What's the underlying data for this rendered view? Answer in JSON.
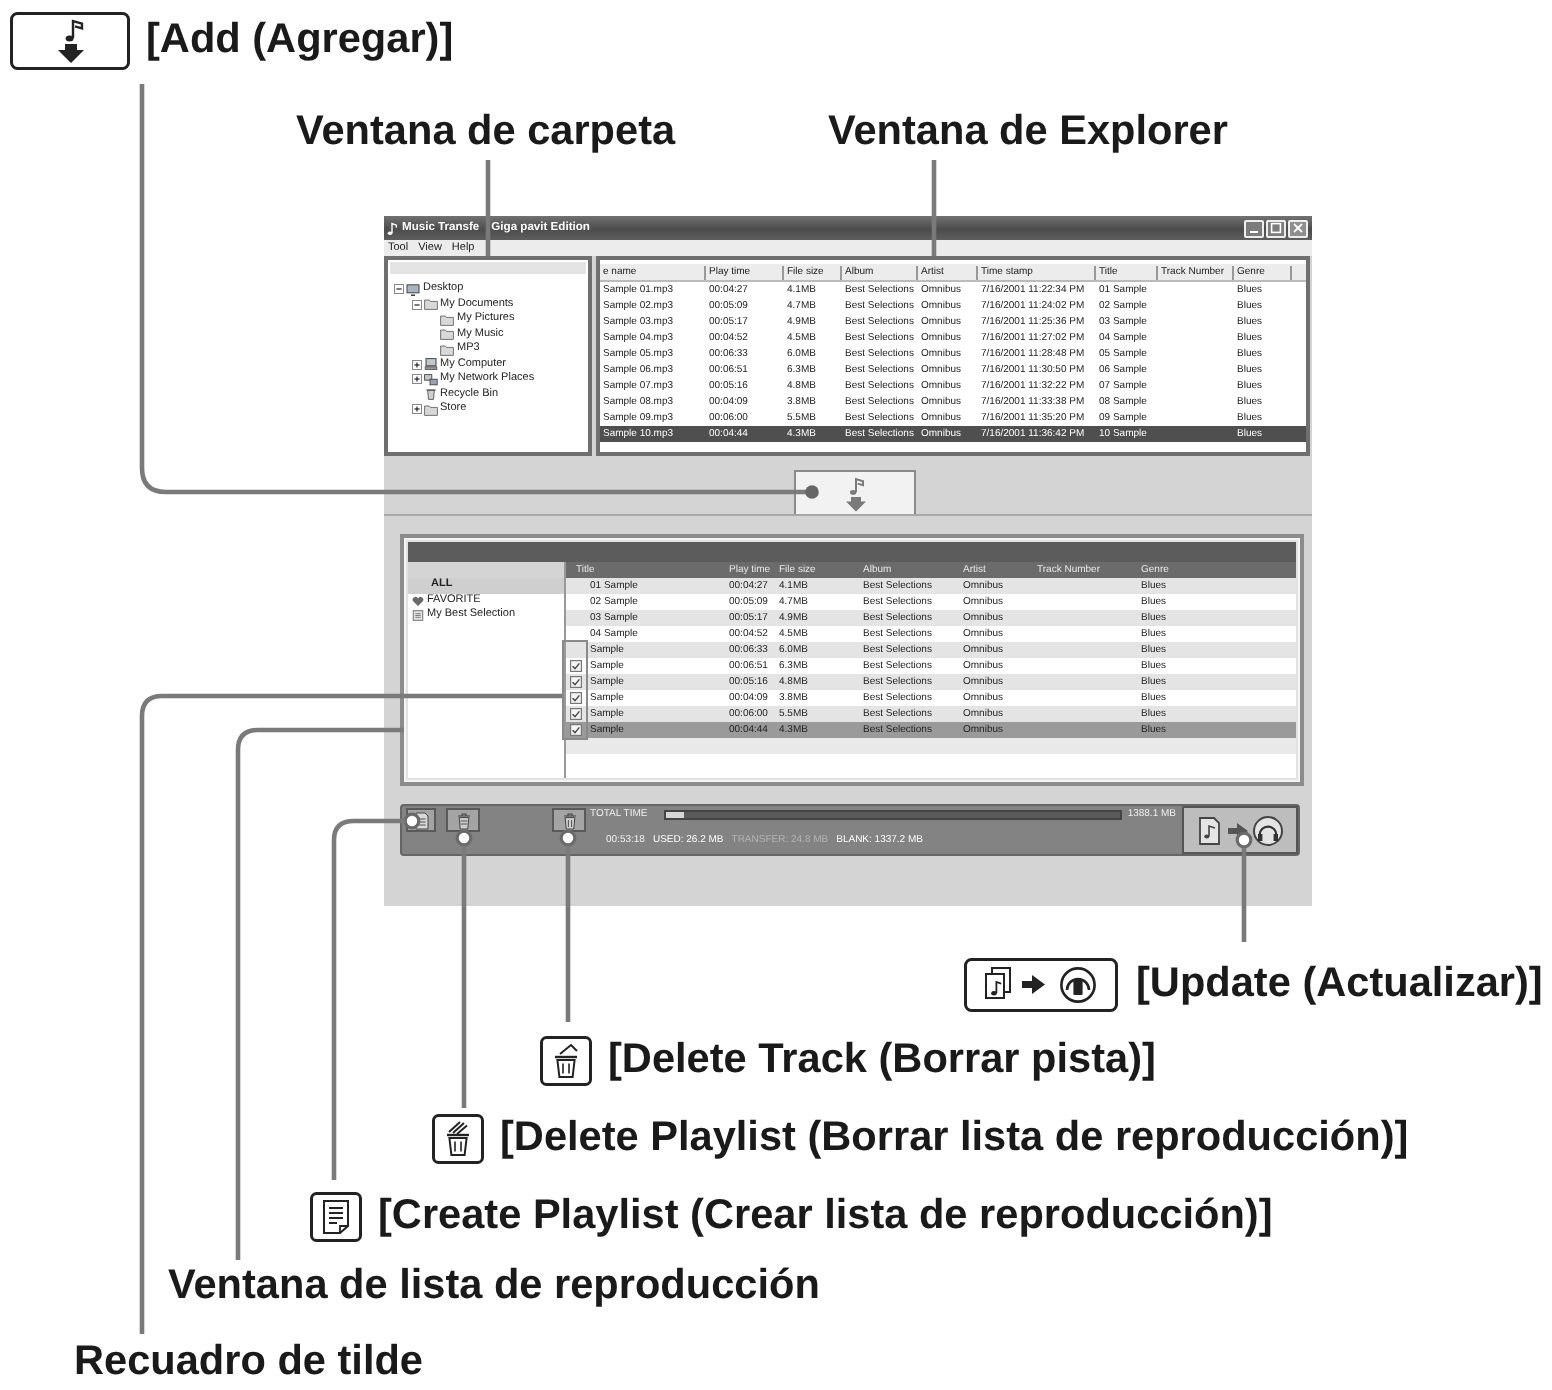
{
  "top_callouts": {
    "add": "[Add (Agregar)]",
    "folder_window": "Ventana de carpeta",
    "explorer_window": "Ventana de Explorer"
  },
  "app": {
    "title_parts": [
      "Music Transfe",
      "Giga pavit Edition"
    ],
    "menu": [
      "Tool",
      "View",
      "Help"
    ],
    "folder_tree": [
      {
        "label": "Desktop",
        "kind": "desktop",
        "expanded": true,
        "children": [
          {
            "label": "My Documents",
            "kind": "folder",
            "expanded": true,
            "children": [
              {
                "label": "My Pictures",
                "kind": "folder"
              },
              {
                "label": "My Music",
                "kind": "folder"
              },
              {
                "label": "MP3",
                "kind": "folder"
              }
            ]
          },
          {
            "label": "My Computer",
            "kind": "computer",
            "expanded": false
          },
          {
            "label": "My Network Places",
            "kind": "network",
            "expanded": false
          },
          {
            "label": "Recycle Bin",
            "kind": "trash"
          },
          {
            "label": "Store",
            "kind": "folder",
            "expanded": false
          }
        ]
      }
    ],
    "explorer_table": {
      "columns": [
        "e name",
        "Play time",
        "File size",
        "Album",
        "Artist",
        "Time stamp",
        "Title",
        "Track Number",
        "Genre"
      ],
      "rows": [
        {
          "file": "Sample 01.mp3",
          "play_time": "00:04:27",
          "file_size": "4.1MB",
          "album": "Best Selections",
          "artist": "Omnibus",
          "time_stamp": "7/16/2001 11:22:34 PM",
          "title": "01 Sample",
          "genre": "Blues",
          "selected": false
        },
        {
          "file": "Sample 02.mp3",
          "play_time": "00:05:09",
          "file_size": "4.7MB",
          "album": "Best Selections",
          "artist": "Omnibus",
          "time_stamp": "7/16/2001 11:24:02 PM",
          "title": "02 Sample",
          "genre": "Blues",
          "selected": false
        },
        {
          "file": "Sample 03.mp3",
          "play_time": "00:05:17",
          "file_size": "4.9MB",
          "album": "Best Selections",
          "artist": "Omnibus",
          "time_stamp": "7/16/2001 11:25:36 PM",
          "title": "03 Sample",
          "genre": "Blues",
          "selected": false
        },
        {
          "file": "Sample 04.mp3",
          "play_time": "00:04:52",
          "file_size": "4.5MB",
          "album": "Best Selections",
          "artist": "Omnibus",
          "time_stamp": "7/16/2001 11:27:02 PM",
          "title": "04 Sample",
          "genre": "Blues",
          "selected": false
        },
        {
          "file": "Sample 05.mp3",
          "play_time": "00:06:33",
          "file_size": "6.0MB",
          "album": "Best Selections",
          "artist": "Omnibus",
          "time_stamp": "7/16/2001 11:28:48 PM",
          "title": "05 Sample",
          "genre": "Blues",
          "selected": false
        },
        {
          "file": "Sample 06.mp3",
          "play_time": "00:06:51",
          "file_size": "6.3MB",
          "album": "Best Selections",
          "artist": "Omnibus",
          "time_stamp": "7/16/2001 11:30:50 PM",
          "title": "06 Sample",
          "genre": "Blues",
          "selected": false
        },
        {
          "file": "Sample 07.mp3",
          "play_time": "00:05:16",
          "file_size": "4.8MB",
          "album": "Best Selections",
          "artist": "Omnibus",
          "time_stamp": "7/16/2001 11:32:22 PM",
          "title": "07 Sample",
          "genre": "Blues",
          "selected": false
        },
        {
          "file": "Sample 08.mp3",
          "play_time": "00:04:09",
          "file_size": "3.8MB",
          "album": "Best Selections",
          "artist": "Omnibus",
          "time_stamp": "7/16/2001 11:33:38 PM",
          "title": "08 Sample",
          "genre": "Blues",
          "selected": false
        },
        {
          "file": "Sample 09.mp3",
          "play_time": "00:06:00",
          "file_size": "5.5MB",
          "album": "Best Selections",
          "artist": "Omnibus",
          "time_stamp": "7/16/2001 11:35:20 PM",
          "title": "09 Sample",
          "genre": "Blues",
          "selected": false
        },
        {
          "file": "Sample 10.mp3",
          "play_time": "00:04:44",
          "file_size": "4.3MB",
          "album": "Best Selections",
          "artist": "Omnibus",
          "time_stamp": "7/16/2001 11:36:42 PM",
          "title": "10 Sample",
          "genre": "Blues",
          "selected": true
        }
      ]
    },
    "playlists": [
      {
        "label": "ALL",
        "kind": "all",
        "selected": true
      },
      {
        "label": "FAVORITE",
        "kind": "favorite",
        "selected": false
      },
      {
        "label": "My Best Selection",
        "kind": "playlist",
        "selected": false
      }
    ],
    "track_table": {
      "columns": [
        "Title",
        "Play time",
        "File size",
        "Album",
        "Artist",
        "Track Number",
        "Genre"
      ],
      "rows": [
        {
          "title": "01 Sample",
          "play_time": "00:04:27",
          "file_size": "4.1MB",
          "album": "Best Selections",
          "artist": "Omnibus",
          "genre": "Blues",
          "checked": false,
          "selected": false
        },
        {
          "title": "02 Sample",
          "play_time": "00:05:09",
          "file_size": "4.7MB",
          "album": "Best Selections",
          "artist": "Omnibus",
          "genre": "Blues",
          "checked": false,
          "selected": false
        },
        {
          "title": "03 Sample",
          "play_time": "00:05:17",
          "file_size": "4.9MB",
          "album": "Best Selections",
          "artist": "Omnibus",
          "genre": "Blues",
          "checked": false,
          "selected": false
        },
        {
          "title": "04 Sample",
          "play_time": "00:04:52",
          "file_size": "4.5MB",
          "album": "Best Selections",
          "artist": "Omnibus",
          "genre": "Blues",
          "checked": false,
          "selected": false
        },
        {
          "title": "Sample",
          "play_time": "00:06:33",
          "file_size": "6.0MB",
          "album": "Best Selections",
          "artist": "Omnibus",
          "genre": "Blues",
          "checked": false,
          "selected": false
        },
        {
          "title": "Sample",
          "play_time": "00:06:51",
          "file_size": "6.3MB",
          "album": "Best Selections",
          "artist": "Omnibus",
          "genre": "Blues",
          "checked": true,
          "selected": false
        },
        {
          "title": "Sample",
          "play_time": "00:05:16",
          "file_size": "4.8MB",
          "album": "Best Selections",
          "artist": "Omnibus",
          "genre": "Blues",
          "checked": true,
          "selected": false
        },
        {
          "title": "Sample",
          "play_time": "00:04:09",
          "file_size": "3.8MB",
          "album": "Best Selections",
          "artist": "Omnibus",
          "genre": "Blues",
          "checked": true,
          "selected": false
        },
        {
          "title": "Sample",
          "play_time": "00:06:00",
          "file_size": "5.5MB",
          "album": "Best Selections",
          "artist": "Omnibus",
          "genre": "Blues",
          "checked": true,
          "selected": false
        },
        {
          "title": "Sample",
          "play_time": "00:04:44",
          "file_size": "4.3MB",
          "album": "Best Selections",
          "artist": "Omnibus",
          "genre": "Blues",
          "checked": true,
          "selected": true
        }
      ]
    },
    "bottom_bar": {
      "total_time_label": "TOTAL TIME",
      "capacity": {
        "level": 0.04
      },
      "capacity_total": "1388.1 MB",
      "total_time": "00:53:18",
      "stats": [
        {
          "text": "USED: 26.2 MB",
          "color": "#ffffff"
        },
        {
          "text": "TRANSFER: 24.8 MB",
          "color": "#b4b4b4"
        },
        {
          "text": "BLANK: 1337.2 MB",
          "color": "#ffffff"
        }
      ]
    }
  },
  "bottom_callouts": {
    "update": "[Update (Actualizar)]",
    "delete_track": "[Delete Track (Borrar pista)]",
    "delete_playlist": "[Delete Playlist (Borrar lista de reproducción)]",
    "create_playlist": "[Create Playlist (Crear lista de reproducción)]",
    "playlist_window": "Ventana de lista de reproducción",
    "checkbox": "Recuadro de tilde"
  }
}
